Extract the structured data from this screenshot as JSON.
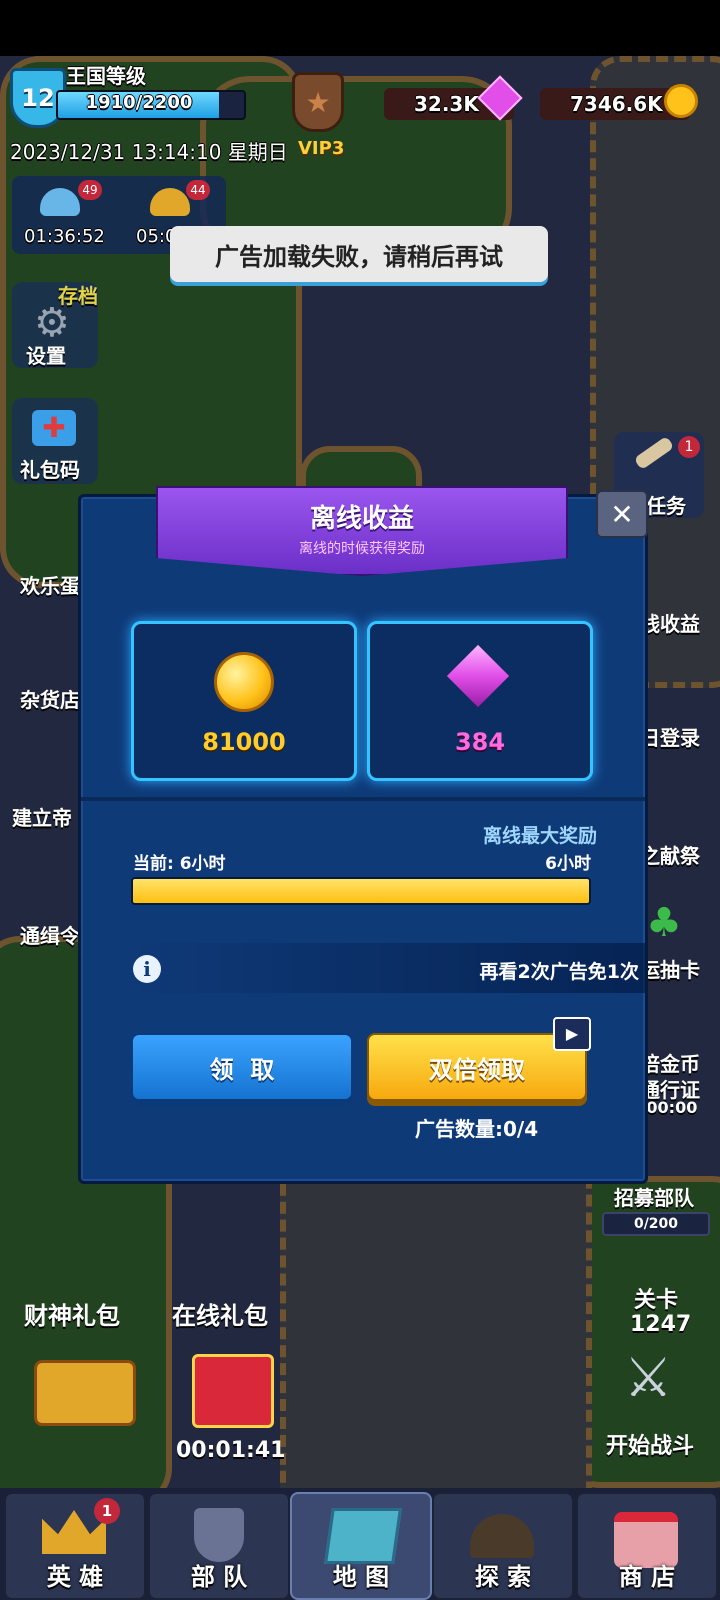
{
  "hud": {
    "kingdom_level": "12",
    "kingdom_label": "王国等级",
    "exp_text": "1910/2200",
    "exp_progress": 0.868,
    "datetime": "2023/12/31 13:14:10 星期日",
    "vip": "VIP3",
    "gems": "32.3K",
    "gold": "7346.6K"
  },
  "timers": {
    "timer1": "01:36:52",
    "timer1_badge": "49",
    "timer2": "05:0",
    "timer2_badge": "44"
  },
  "toast": "广告加载失败，请稍后再试",
  "left_menu": {
    "archive": "存档",
    "settings": "设置",
    "gift_code": "礼包码",
    "happy": "欢乐蛋",
    "store": "杂货店",
    "build": "建立帝",
    "wanted": "通缉令"
  },
  "right_menu": {
    "task": "任务",
    "task_badge": "1",
    "offline": "线收益",
    "daily": "日登录",
    "offering": "之献祭",
    "lucky": "运抽卡",
    "pass_line1": "倍金币",
    "pass_line2": "通行证",
    "pass_timer": ":00:00",
    "recruit": "招募部队",
    "recruit_count": "0/200",
    "stage_label": "关卡",
    "stage_number": "1247",
    "start_battle": "开始战斗"
  },
  "bottom_gifts": {
    "fortune": "财神礼包",
    "online": "在线礼包",
    "online_timer": "00:01:41"
  },
  "panel": {
    "title": "离线收益",
    "subtitle": "离线的时候获得奖励",
    "gold_amount": "81000",
    "gem_amount": "384",
    "max_reward_label": "离线最大奖励",
    "current_label": "当前: 6小时",
    "max_hours": "6小时",
    "progress": 1.0,
    "ad_hint": "再看2次广告免1次",
    "claim_label": "领  取",
    "double_label": "双倍领取",
    "ad_count": "广告数量:0/4"
  },
  "tabs": [
    {
      "label": "英 雄",
      "badge": "1"
    },
    {
      "label": "部 队"
    },
    {
      "label": "地 图"
    },
    {
      "label": "探 索"
    },
    {
      "label": "商 店"
    }
  ],
  "colors": {
    "panel_bg": "#0f3a78",
    "header_purple": "#7b3fd6",
    "slot_glow": "#35c4ff",
    "gold_text": "#ffcc2a",
    "gem_text": "#ff6adf",
    "claim_blue": "#1f86e6",
    "double_yellow": "#ffc21a"
  }
}
